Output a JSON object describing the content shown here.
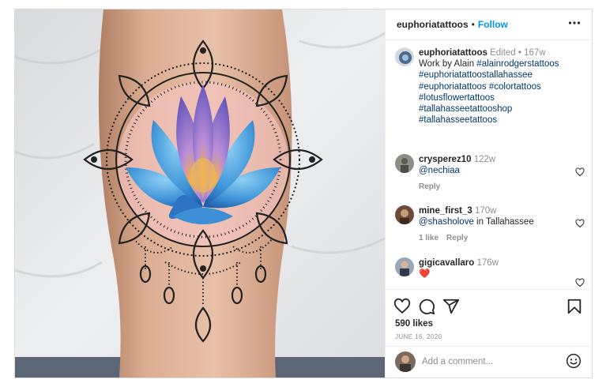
{
  "post": {
    "username": "euphoriatattoos",
    "separator": "•",
    "follow_label": "Follow",
    "more_icon": "more-horizontal-icon",
    "image_alt": "Lotus mandala color tattoo on calf"
  },
  "caption": {
    "username": "euphoriatattoos",
    "edited": "Edited",
    "dot": "•",
    "age": "167w",
    "text_lead": "Work by Alain ",
    "tags": [
      "#alainrodgerstattoos",
      "#euphoriatattoostallahassee",
      "#euphoriatattoos",
      "#colortattoos",
      "#lotusflowertattoos",
      "#tallahasseetattooshop",
      "#tallahasseetattoos"
    ]
  },
  "comments": [
    {
      "username": "crysperez10",
      "age": "122w",
      "mention": "@nechiaa",
      "rest": "",
      "likes": "",
      "reply_label": "Reply"
    },
    {
      "username": "mine_first_3",
      "age": "170w",
      "mention": "@shasholove",
      "rest": " in Tallahassee",
      "likes": "1 like",
      "reply_label": "Reply"
    },
    {
      "username": "gigicavallaro",
      "age": "176w",
      "mention": "",
      "rest": "❤️",
      "likes": "",
      "reply_label": ""
    }
  ],
  "actions": {
    "like_icon": "heart-icon",
    "comment_icon": "comment-icon",
    "share_icon": "send-icon",
    "save_icon": "bookmark-icon",
    "likes_count": "590 likes",
    "date": "JUNE 16, 2020"
  },
  "add_comment": {
    "placeholder": "Add a comment...",
    "emoji_icon": "emoji-icon"
  },
  "colors": {
    "follow": "#0095f6",
    "hashtag": "#00376b",
    "meta": "#8e8e8e",
    "border": "#dbdbdb"
  }
}
